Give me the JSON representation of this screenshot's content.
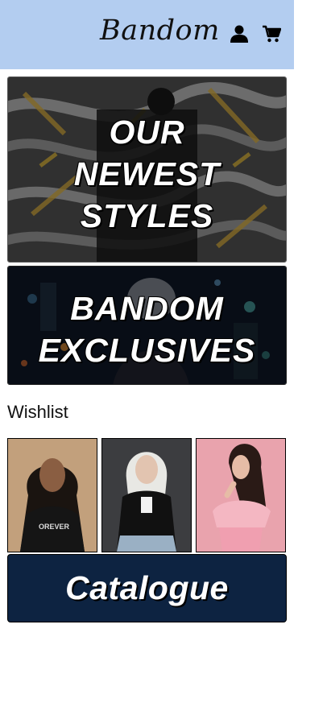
{
  "header": {
    "brand": "Bandom",
    "background": "#b3cdf0",
    "icons": [
      "user-icon",
      "shopping-cart-icon"
    ]
  },
  "banners": [
    {
      "lines": [
        "OUR",
        "NEWEST",
        "STYLES"
      ]
    },
    {
      "lines": [
        "BANDOM",
        "EXCLUSIVES"
      ]
    }
  ],
  "wishlist": {
    "label": "Wishlist"
  },
  "catalogue": {
    "label": "Catalogue",
    "background": "#0d2341"
  }
}
